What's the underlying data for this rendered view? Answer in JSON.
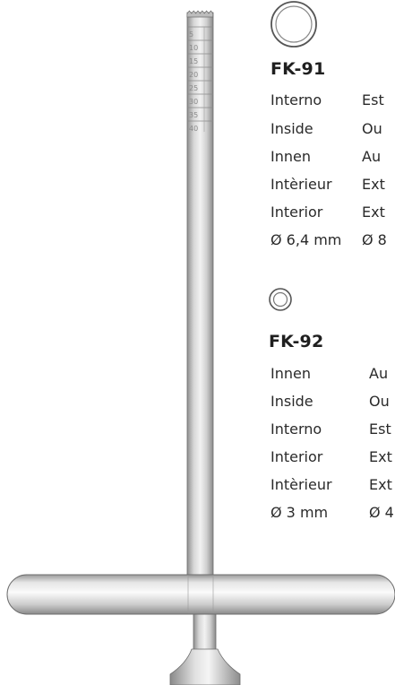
{
  "scale_marks": [
    "5",
    "10",
    "15",
    "20",
    "25",
    "30",
    "35",
    "40"
  ],
  "products": [
    {
      "code": "FK-91",
      "rows": [
        {
          "left": "Interno",
          "right": "Est"
        },
        {
          "left": "Inside",
          "right": "Ou"
        },
        {
          "left": "Innen",
          "right": "Au"
        },
        {
          "left": "Intèrieur",
          "right": "Ext"
        },
        {
          "left": "Interior",
          "right": "Ext"
        },
        {
          "left": "Ø 6,4 mm",
          "right": "Ø 8"
        }
      ]
    },
    {
      "code": "FK-92",
      "rows": [
        {
          "left": "Innen",
          "right": "Au"
        },
        {
          "left": "Inside",
          "right": "Ou"
        },
        {
          "left": "Interno",
          "right": "Est"
        },
        {
          "left": "Interior",
          "right": "Ext"
        },
        {
          "left": "Intèrieur",
          "right": "Ext"
        },
        {
          "left": "Ø 3 mm",
          "right": "Ø 4"
        }
      ]
    }
  ]
}
